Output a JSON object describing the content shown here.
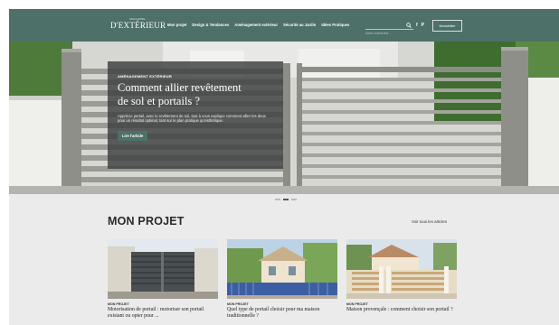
{
  "header": {
    "logo": {
      "top": "MAGAZINE",
      "main": "D'EXTÉRIEUR",
      "bottom": ""
    },
    "nav": [
      "Mon projet",
      "Design & Tendances",
      "Aménagement extérieur",
      "Sécurité au Jardin",
      "Idées Pratiques"
    ],
    "search_placeholder": "Votre recherche...",
    "newsletter_label": "Newsletter",
    "colors": {
      "primary": "#4d7068"
    }
  },
  "hero": {
    "kicker": "AMÉNAGEMENT EXTÉRIEUR",
    "title_line1": "Comment allier revêtement",
    "title_line2": "de sol et portails ?",
    "excerpt": "Apprécie portail, avec le revêtement de sol, tout à vous explique comment allier les deux pour un résultat optimal, tant sur le plan pratique qu'esthétique.",
    "cta_label": "Lire l'article",
    "slide_count": 3,
    "active_slide": 2
  },
  "section": {
    "title": "MON PROJET",
    "see_all": "Voir tous les articles",
    "articles": [
      {
        "category": "MON PROJET",
        "title": "Motorisation de portail : motoriser son portail existant ou opter pour ...",
        "image": "gate-photo"
      },
      {
        "category": "MON PROJET",
        "title": "Quel type de portail choisir pour ma maison traditionnelle ?",
        "image": "house-photo"
      },
      {
        "category": "MON PROJET",
        "title": "Maison provençale : comment choisir son portail ?",
        "image": "fence-photo"
      }
    ]
  },
  "icons": {
    "search": "search-icon",
    "facebook": "facebook-icon",
    "pinterest": "pinterest-icon"
  }
}
